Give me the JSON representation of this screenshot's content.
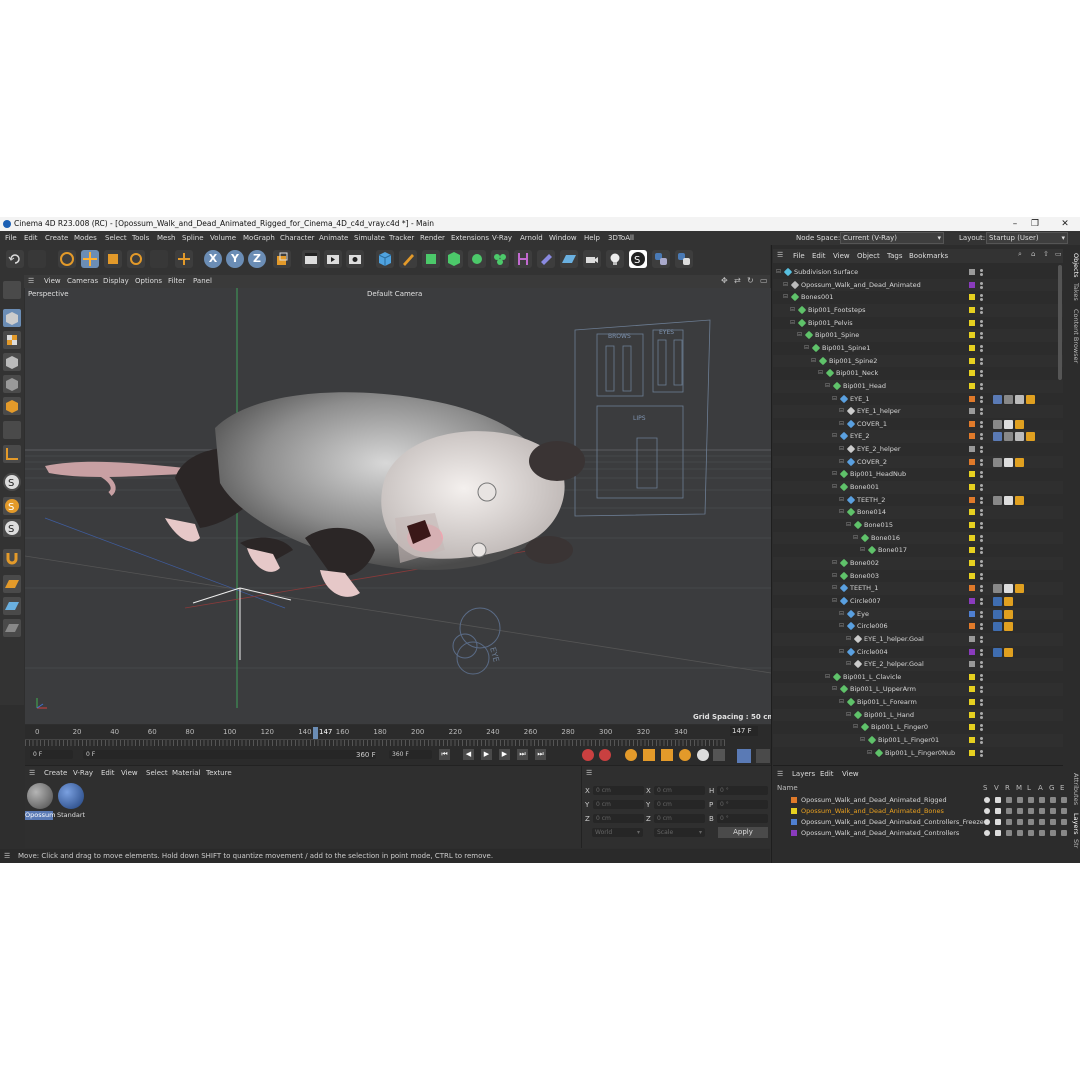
{
  "window": {
    "title": "Cinema 4D R23.008 (RC) - [Opossum_Walk_and_Dead_Animated_Rigged_for_Cinema_4D_c4d_vray.c4d *] - Main"
  },
  "menu": [
    "File",
    "Edit",
    "Create",
    "Modes",
    "Select",
    "Tools",
    "Mesh",
    "Spline",
    "Volume",
    "MoGraph",
    "Character",
    "Animate",
    "Simulate",
    "Tracker",
    "Render",
    "Extensions",
    "V-Ray",
    "Arnold",
    "Window",
    "Help",
    "3DToAll"
  ],
  "node_space": {
    "label": "Node Space:",
    "value": "Current (V-Ray)"
  },
  "layout": {
    "label": "Layout:",
    "value": "Startup (User)"
  },
  "axis_buttons": [
    "X",
    "Y",
    "Z"
  ],
  "viewport_menu": [
    "View",
    "Cameras",
    "Display",
    "Options",
    "Filter",
    "Panel"
  ],
  "viewport": {
    "view_name": "Perspective",
    "camera": "Default Camera",
    "grid_spacing": "Grid Spacing : 50 cm",
    "rig_labels": {
      "brows": "BROWS",
      "eyes": "EYES",
      "lips": "LIPS",
      "eye": "EYE"
    }
  },
  "timeline": {
    "ticks": [
      "0",
      "20",
      "40",
      "60",
      "80",
      "100",
      "120",
      "140",
      "160",
      "180",
      "200",
      "220",
      "240",
      "260",
      "280",
      "300",
      "320",
      "340"
    ],
    "current_frame": "147",
    "end_field": "147 F",
    "start": "0 F",
    "range_start": "0 F",
    "range_end": "360 F",
    "end": "360 F"
  },
  "material_menu": [
    "Create",
    "V-Ray",
    "Edit",
    "View",
    "Select",
    "Material",
    "Texture"
  ],
  "materials": [
    {
      "name": "Opossum",
      "color": "#7a7a7a"
    },
    {
      "name": "Standart",
      "color": "#3f6db0"
    }
  ],
  "coords": {
    "rows": [
      {
        "a": "X",
        "av": "0 cm",
        "b": "X",
        "bv": "0 cm",
        "c": "H",
        "cv": "0 °"
      },
      {
        "a": "Y",
        "av": "0 cm",
        "b": "Y",
        "bv": "0 cm",
        "c": "P",
        "cv": "0 °"
      },
      {
        "a": "Z",
        "av": "0 cm",
        "b": "Z",
        "bv": "0 cm",
        "c": "B",
        "cv": "0 °"
      }
    ],
    "world": "World",
    "scale": "Scale",
    "apply": "Apply"
  },
  "status": "Move: Click and drag to move elements. Hold down SHIFT to quantize movement / add to the selection in point mode, CTRL to remove.",
  "objects_menu": [
    "File",
    "Edit",
    "View",
    "Object",
    "Tags",
    "Bookmarks"
  ],
  "objects": [
    {
      "name": "Subdivision Surface",
      "indent": 0,
      "color": "#9a9a9a",
      "icon": "#58c0e0",
      "tags": []
    },
    {
      "name": "Opossum_Walk_and_Dead_Animated",
      "indent": 1,
      "color": "#8a3bbd",
      "icon": "#bbb",
      "tags": []
    },
    {
      "name": "Bones001",
      "indent": 1,
      "color": "#e6d020",
      "icon": "#5fc26a",
      "tags": []
    },
    {
      "name": "Bip001_Footsteps",
      "indent": 2,
      "color": "#e6d020",
      "icon": "#5fc26a",
      "tags": []
    },
    {
      "name": "Bip001_Pelvis",
      "indent": 2,
      "color": "#e6d020",
      "icon": "#5fc26a",
      "tags": []
    },
    {
      "name": "Bip001_Spine",
      "indent": 3,
      "color": "#e6d020",
      "icon": "#5fc26a",
      "tags": []
    },
    {
      "name": "Bip001_Spine1",
      "indent": 4,
      "color": "#e6d020",
      "icon": "#5fc26a",
      "tags": []
    },
    {
      "name": "Bip001_Spine2",
      "indent": 5,
      "color": "#e6d020",
      "icon": "#5fc26a",
      "tags": []
    },
    {
      "name": "Bip001_Neck",
      "indent": 6,
      "color": "#e6d020",
      "icon": "#5fc26a",
      "tags": []
    },
    {
      "name": "Bip001_Head",
      "indent": 7,
      "color": "#e6d020",
      "icon": "#5fc26a",
      "tags": []
    },
    {
      "name": "EYE_1",
      "indent": 8,
      "color": "#e07a2a",
      "icon": "#5aa0e0",
      "tags": [
        "#5a7ab5",
        "#888",
        "#bbb",
        "#e0a020"
      ]
    },
    {
      "name": "EYE_1_helper",
      "indent": 9,
      "color": "#9a9a9a",
      "icon": "#ccc",
      "tags": []
    },
    {
      "name": "COVER_1",
      "indent": 9,
      "color": "#e07a2a",
      "icon": "#5aa0e0",
      "tags": [
        "#888",
        "#ddd",
        "#e0a020"
      ]
    },
    {
      "name": "EYE_2",
      "indent": 8,
      "color": "#e07a2a",
      "icon": "#5aa0e0",
      "tags": [
        "#5a7ab5",
        "#888",
        "#bbb",
        "#e0a020"
      ]
    },
    {
      "name": "EYE_2_helper",
      "indent": 9,
      "color": "#9a9a9a",
      "icon": "#ccc",
      "tags": []
    },
    {
      "name": "COVER_2",
      "indent": 9,
      "color": "#e07a2a",
      "icon": "#5aa0e0",
      "tags": [
        "#888",
        "#ddd",
        "#e0a020"
      ]
    },
    {
      "name": "Bip001_HeadNub",
      "indent": 8,
      "color": "#e6d020",
      "icon": "#5fc26a",
      "tags": []
    },
    {
      "name": "Bone001",
      "indent": 8,
      "color": "#e6d020",
      "icon": "#5fc26a",
      "tags": []
    },
    {
      "name": "TEETH_2",
      "indent": 9,
      "color": "#e07a2a",
      "icon": "#5aa0e0",
      "tags": [
        "#888",
        "#ddd",
        "#e0a020"
      ]
    },
    {
      "name": "Bone014",
      "indent": 9,
      "color": "#e6d020",
      "icon": "#5fc26a",
      "tags": []
    },
    {
      "name": "Bone015",
      "indent": 10,
      "color": "#e6d020",
      "icon": "#5fc26a",
      "tags": []
    },
    {
      "name": "Bone016",
      "indent": 11,
      "color": "#e6d020",
      "icon": "#5fc26a",
      "tags": []
    },
    {
      "name": "Bone017",
      "indent": 12,
      "color": "#e6d020",
      "icon": "#5fc26a",
      "tags": []
    },
    {
      "name": "Bone002",
      "indent": 8,
      "color": "#e6d020",
      "icon": "#5fc26a",
      "tags": []
    },
    {
      "name": "Bone003",
      "indent": 8,
      "color": "#e6d020",
      "icon": "#5fc26a",
      "tags": []
    },
    {
      "name": "TEETH_1",
      "indent": 8,
      "color": "#e07a2a",
      "icon": "#5aa0e0",
      "tags": [
        "#888",
        "#ddd",
        "#e0a020"
      ]
    },
    {
      "name": "Circle007",
      "indent": 8,
      "color": "#8a3bbd",
      "icon": "#5aa0e0",
      "tags": [
        "#3f6db0",
        "#e0a020"
      ]
    },
    {
      "name": "Eye",
      "indent": 9,
      "color": "#4f7fd0",
      "icon": "#5aa0e0",
      "tags": [
        "#3f6db0",
        "#e0a020"
      ]
    },
    {
      "name": "Circle006",
      "indent": 9,
      "color": "#e07a2a",
      "icon": "#5aa0e0",
      "tags": [
        "#3f6db0",
        "#e0a020"
      ]
    },
    {
      "name": "EYE_1_helper.Goal",
      "indent": 10,
      "color": "#9a9a9a",
      "icon": "#ccc",
      "tags": []
    },
    {
      "name": "Circle004",
      "indent": 9,
      "color": "#8a3bbd",
      "icon": "#5aa0e0",
      "tags": [
        "#3f6db0",
        "#e0a020"
      ]
    },
    {
      "name": "EYE_2_helper.Goal",
      "indent": 10,
      "color": "#9a9a9a",
      "icon": "#ccc",
      "tags": []
    },
    {
      "name": "Bip001_L_Clavicle",
      "indent": 7,
      "color": "#e6d020",
      "icon": "#5fc26a",
      "tags": []
    },
    {
      "name": "Bip001_L_UpperArm",
      "indent": 8,
      "color": "#e6d020",
      "icon": "#5fc26a",
      "tags": []
    },
    {
      "name": "Bip001_L_Forearm",
      "indent": 9,
      "color": "#e6d020",
      "icon": "#5fc26a",
      "tags": []
    },
    {
      "name": "Bip001_L_Hand",
      "indent": 10,
      "color": "#e6d020",
      "icon": "#5fc26a",
      "tags": []
    },
    {
      "name": "Bip001_L_Finger0",
      "indent": 11,
      "color": "#e6d020",
      "icon": "#5fc26a",
      "tags": []
    },
    {
      "name": "Bip001_L_Finger01",
      "indent": 12,
      "color": "#e6d020",
      "icon": "#5fc26a",
      "tags": []
    },
    {
      "name": "Bip001_L_Finger0Nub",
      "indent": 13,
      "color": "#e6d020",
      "icon": "#5fc26a",
      "tags": []
    }
  ],
  "layers_menu": [
    "Layers",
    "Edit",
    "View"
  ],
  "layers_header": {
    "name": "Name",
    "cols": [
      "S",
      "V",
      "R",
      "M",
      "L",
      "A",
      "G",
      "E"
    ]
  },
  "layers": [
    {
      "name": "Opossum_Walk_and_Dead_Animated_Rigged",
      "color": "#e07a2a",
      "text": "#d6d6d6"
    },
    {
      "name": "Opossum_Walk_and_Dead_Animated_Bones",
      "color": "#e6d020",
      "text": "#e8a020"
    },
    {
      "name": "Opossum_Walk_and_Dead_Animated_Controllers_Freeze",
      "color": "#4f7fd0",
      "text": "#d6d6d6"
    },
    {
      "name": "Opossum_Walk_and_Dead_Animated_Controllers",
      "color": "#8a3bbd",
      "text": "#d6d6d6"
    }
  ],
  "side_tabs": [
    "Objects",
    "Takes",
    "Content Browser",
    "Attributes",
    "Layers",
    "Str"
  ]
}
